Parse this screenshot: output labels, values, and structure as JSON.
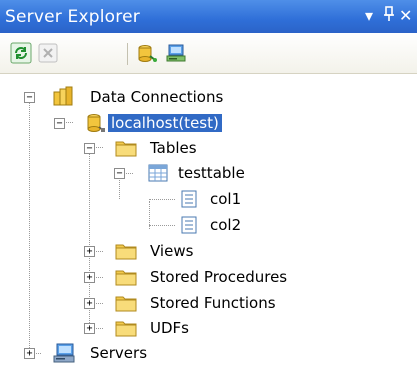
{
  "window": {
    "title": "Server Explorer",
    "controls": {
      "dropdown": "▾",
      "pin": "ᵖ",
      "close": "✕"
    }
  },
  "toolbar": {
    "buttons": [
      {
        "name": "refresh-icon"
      },
      {
        "name": "stop-icon"
      },
      {
        "name": "connect-to-database-icon"
      },
      {
        "name": "connect-to-server-icon"
      }
    ]
  },
  "tree": {
    "data_connections": "Data Connections",
    "connection": "localhost(test)",
    "tables": "Tables",
    "table": "testtable",
    "columns": [
      "col1",
      "col2"
    ],
    "views": "Views",
    "stored_procedures": "Stored Procedures",
    "stored_functions": "Stored Functions",
    "udfs": "UDFs",
    "servers": "Servers",
    "expander_expanded": "−",
    "expander_collapsed": "+"
  },
  "colors": {
    "title_bar": "#2f6fd8",
    "selection": "#316ac5",
    "folder": "#f2c94c"
  }
}
